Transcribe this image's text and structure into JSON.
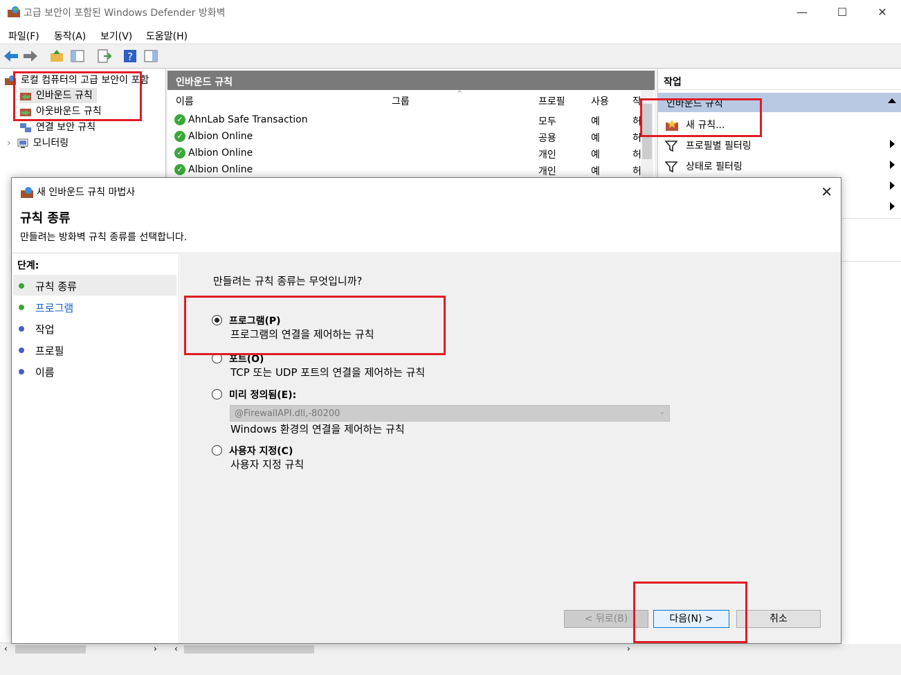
{
  "window": {
    "title": "고급 보안이 포함된 Windows Defender 방화벽",
    "minimize": "—",
    "maximize": "☐",
    "close": "✕"
  },
  "menu": [
    "파일(F)",
    "동작(A)",
    "보기(V)",
    "도움말(H)"
  ],
  "tree": {
    "root": "로컬 컴퓨터의 고급 보안이 포함",
    "items": [
      "인바운드 규칙",
      "아웃바운드 규칙",
      "연결 보안 규칙",
      "모니터링"
    ]
  },
  "center": {
    "header": "인바운드 규칙",
    "columns": [
      "이름",
      "그룹",
      "프로필",
      "사용",
      "작"
    ],
    "rows": [
      {
        "name": "AhnLab Safe Transaction",
        "group": "",
        "profile": "모두",
        "enabled": "예",
        "action": "허"
      },
      {
        "name": "Albion Online",
        "group": "",
        "profile": "공용",
        "enabled": "예",
        "action": "허"
      },
      {
        "name": "Albion Online",
        "group": "",
        "profile": "개인",
        "enabled": "예",
        "action": "허"
      },
      {
        "name": "Albion Online",
        "group": "",
        "profile": "개인",
        "enabled": "예",
        "action": "허"
      }
    ]
  },
  "actions": {
    "header": "작업",
    "subheader": "인바운드 규칙",
    "items": [
      "새 규칙...",
      "프로필별 필터링",
      "상태로 필터링"
    ]
  },
  "dialog": {
    "title": "새 인바운드 규칙 마법사",
    "heading": "규칙 종류",
    "description": "만들려는 방화벽 규칙 종류를 선택합니다.",
    "steps_label": "단계:",
    "steps": [
      {
        "label": "규칙 종류",
        "color": "#3aa73a"
      },
      {
        "label": "프로그램",
        "color": "#3aa73a"
      },
      {
        "label": "작업",
        "color": "#4a5cc9"
      },
      {
        "label": "프로필",
        "color": "#4a5cc9"
      },
      {
        "label": "이름",
        "color": "#4a5cc9"
      }
    ],
    "question": "만들려는 규칙 종류는 무엇입니까?",
    "options": [
      {
        "label": "프로그램(P)",
        "desc": "프로그램의 연결을 제어하는 규칙",
        "selected": true
      },
      {
        "label": "포트(O)",
        "desc": "TCP 또는 UDP 포트의 연결을 제어하는 규칙",
        "selected": false
      },
      {
        "label": "미리 정의됨(E):",
        "desc": "Windows 환경의 연결을 제어하는 규칙",
        "selected": false
      },
      {
        "label": "사용자 지정(C)",
        "desc": "사용자 지정 규칙",
        "selected": false
      }
    ],
    "predefined_value": "@FirewallAPI.dll,-80200",
    "buttons": {
      "back": "< 뒤로(B)",
      "next": "다음(N) >",
      "cancel": "취소"
    }
  },
  "colors": {
    "highlight": "#e01b24",
    "action_header": "#b9c9e4",
    "pane_header": "#7a7a7a"
  }
}
